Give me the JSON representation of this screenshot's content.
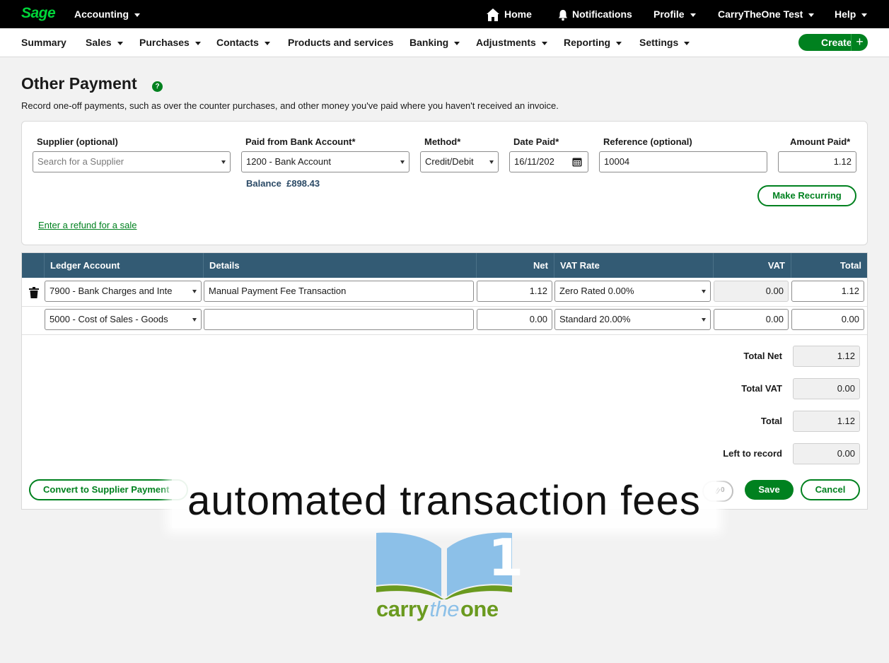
{
  "topbar": {
    "logo": "Sage",
    "product": "Accounting",
    "home": "Home",
    "notifications": "Notifications",
    "profile": "Profile",
    "company": "CarryTheOne Test",
    "help": "Help"
  },
  "nav": {
    "items": [
      "Summary",
      "Sales",
      "Purchases",
      "Contacts",
      "Products and services",
      "Banking",
      "Adjustments",
      "Reporting",
      "Settings"
    ],
    "create": "Create",
    "create_plus": "+"
  },
  "page": {
    "title": "Other Payment",
    "help": "?",
    "subtitle": "Record one-off payments, such as over the counter purchases, and other money you've paid where you haven't received an invoice."
  },
  "form": {
    "supplier_label": "Supplier (optional)",
    "supplier_placeholder": "Search for a Supplier",
    "bank_label": "Paid from Bank Account*",
    "bank_value": "1200 - Bank Account",
    "balance_label": "Balance",
    "balance_value": "£898.43",
    "method_label": "Method*",
    "method_value": "Credit/Debit",
    "date_label": "Date Paid*",
    "date_value": "16/11/202",
    "reference_label": "Reference (optional)",
    "reference_value": "10004",
    "amount_label": "Amount Paid*",
    "amount_value": "1.12",
    "recurring": "Make Recurring",
    "refund_link": "Enter a refund for a sale"
  },
  "grid": {
    "headers": [
      "Ledger Account",
      "Details",
      "Net",
      "VAT Rate",
      "VAT",
      "Total"
    ],
    "rows": [
      {
        "ledger": "7900 - Bank Charges and Inte",
        "details": "Manual Payment Fee Transaction",
        "net": "1.12",
        "vat_rate": "Zero Rated 0.00%",
        "vat": "0.00",
        "total": "1.12"
      },
      {
        "ledger": "5000 - Cost of Sales - Goods",
        "details": "",
        "net": "0.00",
        "vat_rate": "Standard 20.00%",
        "vat": "0.00",
        "total": "0.00"
      }
    ],
    "totals": {
      "net_label": "Total Net",
      "net": "1.12",
      "vat_label": "Total VAT",
      "vat": "0.00",
      "total_label": "Total",
      "total": "1.12",
      "left_label": "Left to record",
      "left": "0.00"
    },
    "convert": "Convert to Supplier Payment",
    "attach_count": "0",
    "save": "Save",
    "cancel": "Cancel"
  },
  "overlay": {
    "caption": "automated transaction fees",
    "brand_carry": "carry",
    "brand_the": "the",
    "brand_one": "one",
    "brand_digit": "1"
  },
  "colors": {
    "accent": "#00811f",
    "grid_header": "#335b74",
    "logo_green": "#00d639",
    "brand_blue": "#8cc0e8",
    "brand_green": "#6a9a1f"
  }
}
